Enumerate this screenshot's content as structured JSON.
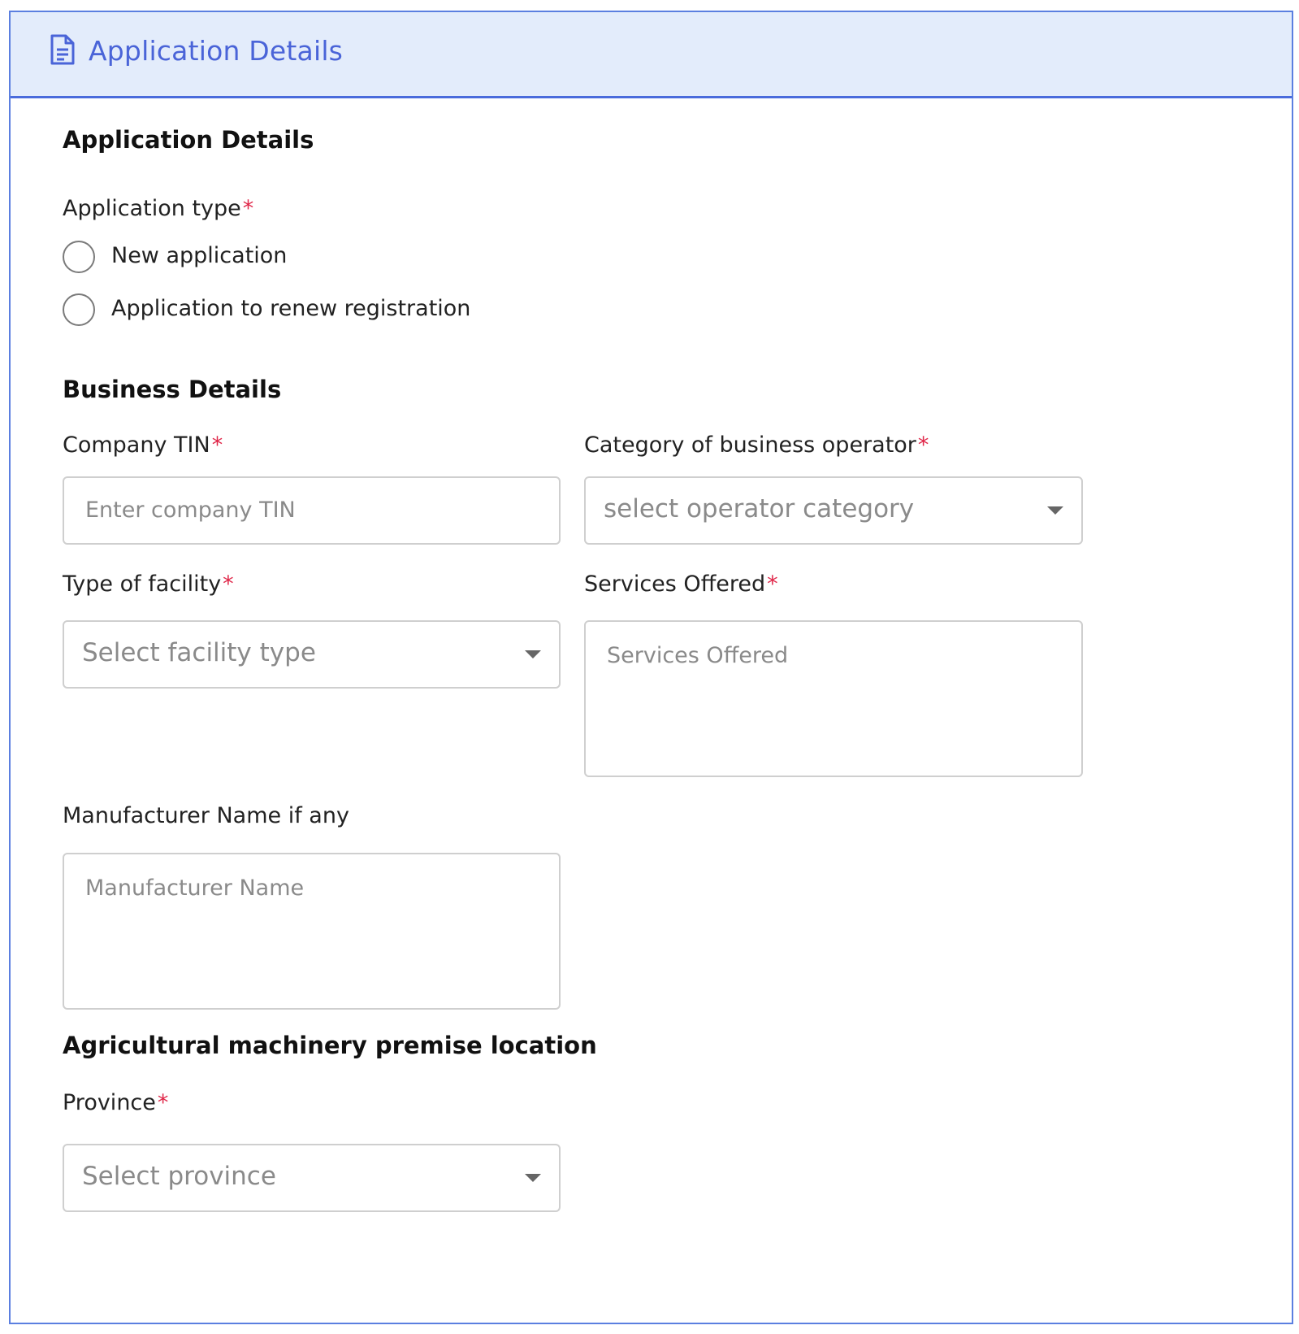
{
  "header": {
    "title": "Application Details",
    "icon": "document-icon"
  },
  "application_section": {
    "title": "Application Details",
    "application_type_label": "Application type",
    "required_mark": "*",
    "options": [
      "New application",
      "Application to renew registration"
    ]
  },
  "business_section": {
    "title": "Business Details",
    "company_tin": {
      "label": "Company TIN",
      "placeholder": "Enter company TIN"
    },
    "operator_category": {
      "label": "Category of business operator",
      "placeholder": "select operator category"
    },
    "facility_type": {
      "label": "Type of facility",
      "placeholder": "Select facility type"
    },
    "services_offered": {
      "label": "Services Offered",
      "placeholder": "Services Offered"
    },
    "manufacturer_name": {
      "label": "Manufacturer Name if any",
      "placeholder": "Manufacturer Name"
    }
  },
  "location_section": {
    "title": "Agricultural machinery premise location",
    "province": {
      "label": "Province",
      "placeholder": "Select province"
    }
  },
  "colors": {
    "accent": "#4a64d8",
    "header_bg": "#e3ecfb",
    "required": "#e0284a",
    "border": "#cfcfcf"
  }
}
